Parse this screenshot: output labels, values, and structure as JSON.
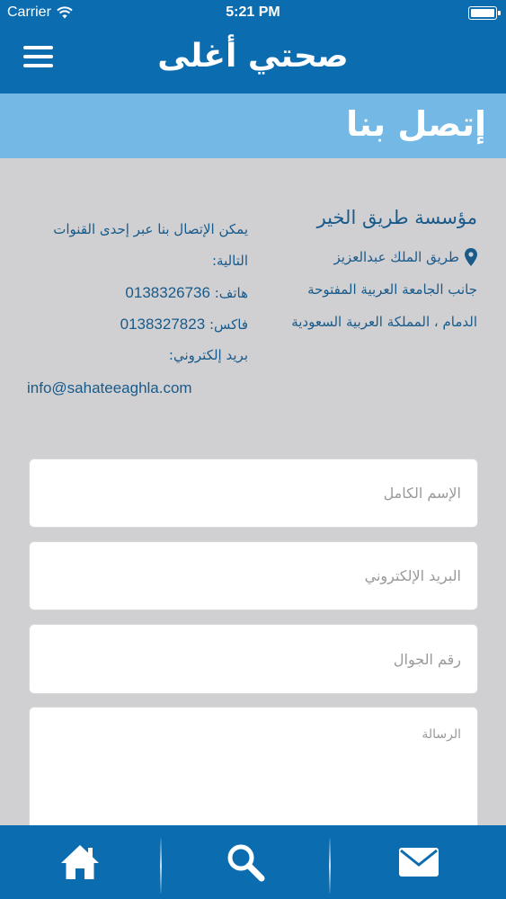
{
  "status_bar": {
    "carrier": "Carrier",
    "time": "5:21 PM"
  },
  "nav": {
    "title": "صحتي أغلى",
    "menu_icon": "hamburger-menu-icon"
  },
  "section": {
    "title": "إتصل بنا"
  },
  "organization": {
    "name": "مؤسسة طريق الخير",
    "address_line_1": "طريق الملك عبدالعزيز",
    "address_line_2": "جانب الجامعة العربية المفتوحة",
    "address_line_3": "الدمام ، المملكة العربية السعودية",
    "location_icon": "map-pin-icon"
  },
  "channels": {
    "intro": "يمكن الإتصال بنا عبر إحدى القنوات التالية:",
    "phone_label": "هاتف:",
    "phone": "0138326736",
    "fax_label": "فاكس:",
    "fax": "0138327823",
    "email_label": "بريد إلكتروني:",
    "email": "info@sahateeaghla.com"
  },
  "form": {
    "name_placeholder": "الإسم الكامل",
    "email_placeholder": "البريد الإلكتروني",
    "mobile_placeholder": "رقم الجوال",
    "message_placeholder": "الرسالة"
  },
  "tabs": [
    {
      "icon": "home-icon"
    },
    {
      "icon": "search-icon"
    },
    {
      "icon": "mail-icon"
    }
  ],
  "colors": {
    "primary": "#0b6db0",
    "section_header": "#74b9e6",
    "background": "#d0d0d3",
    "text": "#185a8a"
  }
}
